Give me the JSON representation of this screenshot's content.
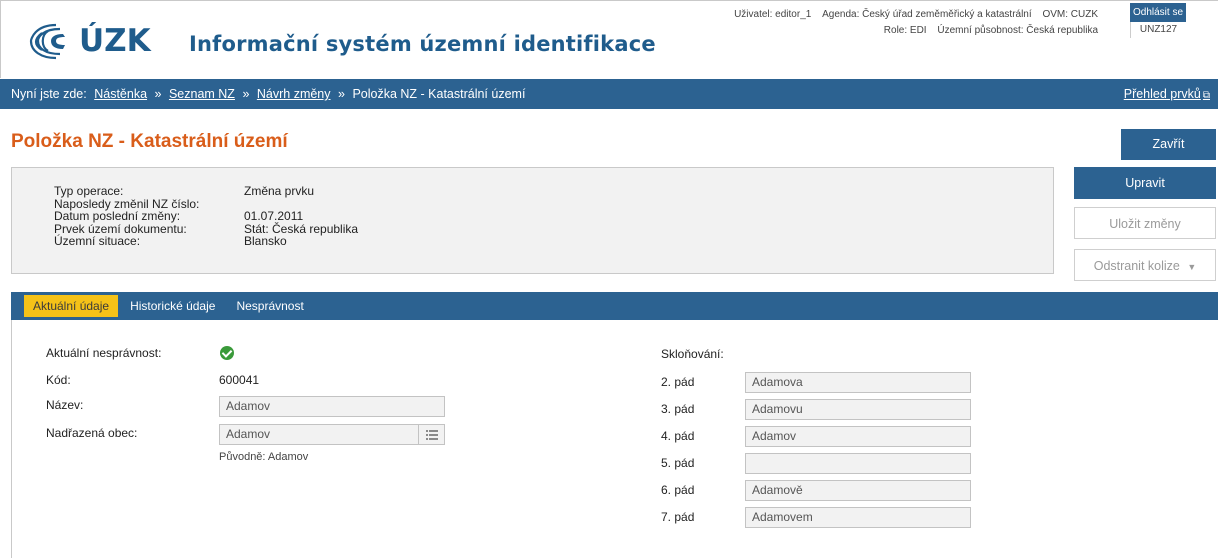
{
  "header": {
    "logo_text": "ÚZK",
    "app_title": "Informační systém územní identifikace",
    "user": "Uživatel: editor_1",
    "agenda": "Agenda: Český úřad zeměměřický a katastrální",
    "ovm": "OVM: CUZK",
    "role": "Role: EDI",
    "scope": "Územní působnost: Česká republika",
    "logout_label": "Odhlásit se",
    "code": "UNZ127"
  },
  "breadcrumb": {
    "prefix": "Nyní jste zde:",
    "items": [
      "Nástěnka",
      "Seznam NZ",
      "Návrh změny"
    ],
    "current": "Položka NZ - Katastrální území",
    "separator": "»",
    "overview_link": "Přehled prvků"
  },
  "page": {
    "title": "Položka NZ - Katastrální území"
  },
  "info": {
    "rows": [
      {
        "label": "Typ operace:",
        "value": "Změna prvku"
      },
      {
        "label": "Naposledy změnil NZ číslo:",
        "value": ""
      },
      {
        "label": "Datum poslední změny:",
        "value": "01.07.2011"
      },
      {
        "label": "Prvek území dokumentu:",
        "value": "Stát: Česká republika"
      },
      {
        "label": "Územní situace:",
        "value": "Blansko"
      }
    ]
  },
  "actions": {
    "close": "Zavřít",
    "edit": "Upravit",
    "save": "Uložit změny",
    "resolve": "Odstranit kolize"
  },
  "tabs": [
    "Aktuální údaje",
    "Historické údaje",
    "Nesprávnost"
  ],
  "form": {
    "incorrect_label": "Aktuální nesprávnost:",
    "code_label": "Kód:",
    "code_value": "600041",
    "name_label": "Název:",
    "name_value": "Adamov",
    "parent_label": "Nadřazená obec:",
    "parent_value": "Adamov",
    "original_note": "Původně: Adamov",
    "declension_label": "Skloňování:",
    "cases": [
      {
        "label": "2. pád",
        "value": "Adamova"
      },
      {
        "label": "3. pád",
        "value": "Adamovu"
      },
      {
        "label": "4. pád",
        "value": "Adamov"
      },
      {
        "label": "5. pád",
        "value": ""
      },
      {
        "label": "6. pád",
        "value": "Adamově"
      },
      {
        "label": "7. pád",
        "value": "Adamovem"
      }
    ]
  },
  "colors": {
    "primary": "#2c6291",
    "title": "#d95d1a",
    "active_tab": "#f5c218",
    "check": "#3a9a3a"
  },
  "icons": {
    "logo": "cuzk-logo-icon",
    "external": "external-link-icon",
    "list": "list-icon",
    "dropdown": "caret-down-icon",
    "check": "check-circle-icon"
  }
}
